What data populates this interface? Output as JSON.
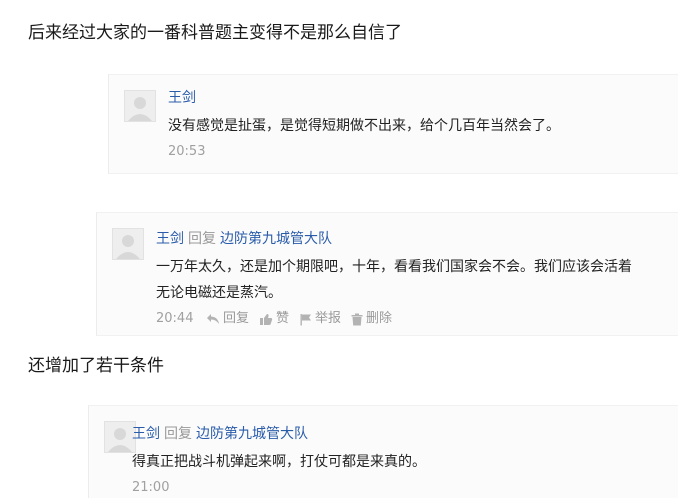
{
  "captions": {
    "first": "后来经过大家的一番科普题主变得不是那么自信了",
    "second": "还增加了若干条件"
  },
  "comments": [
    {
      "author": "王剑",
      "lines": [
        "没有感觉是扯蛋，是觉得短期做不出来，给个几百年当然会了。"
      ],
      "time": "20:53"
    },
    {
      "author": "王剑",
      "reply_word": "回复",
      "reply_to": "边防第九城管大队",
      "lines": [
        "一万年太久，还是加个期限吧，十年，看看我们国家会不会。我们应该会活着",
        "无论电磁还是蒸汽。"
      ],
      "time": "20:44",
      "actions": {
        "reply": "回复",
        "like": "赞",
        "report": "举报",
        "delete": "删除"
      }
    },
    {
      "author": "王剑",
      "reply_word": "回复",
      "reply_to": "边防第九城管大队",
      "lines": [
        "得真正把战斗机弹起来啊，打仗可都是来真的。"
      ],
      "time": "21:00"
    }
  ],
  "colors": {
    "link": "#2a5caa",
    "muted": "#999999",
    "text": "#222222"
  },
  "icons": {
    "avatar": "default-avatar-icon",
    "reply": "reply-icon",
    "like": "thumbs-up-icon",
    "report": "flag-icon",
    "delete": "trash-icon"
  }
}
